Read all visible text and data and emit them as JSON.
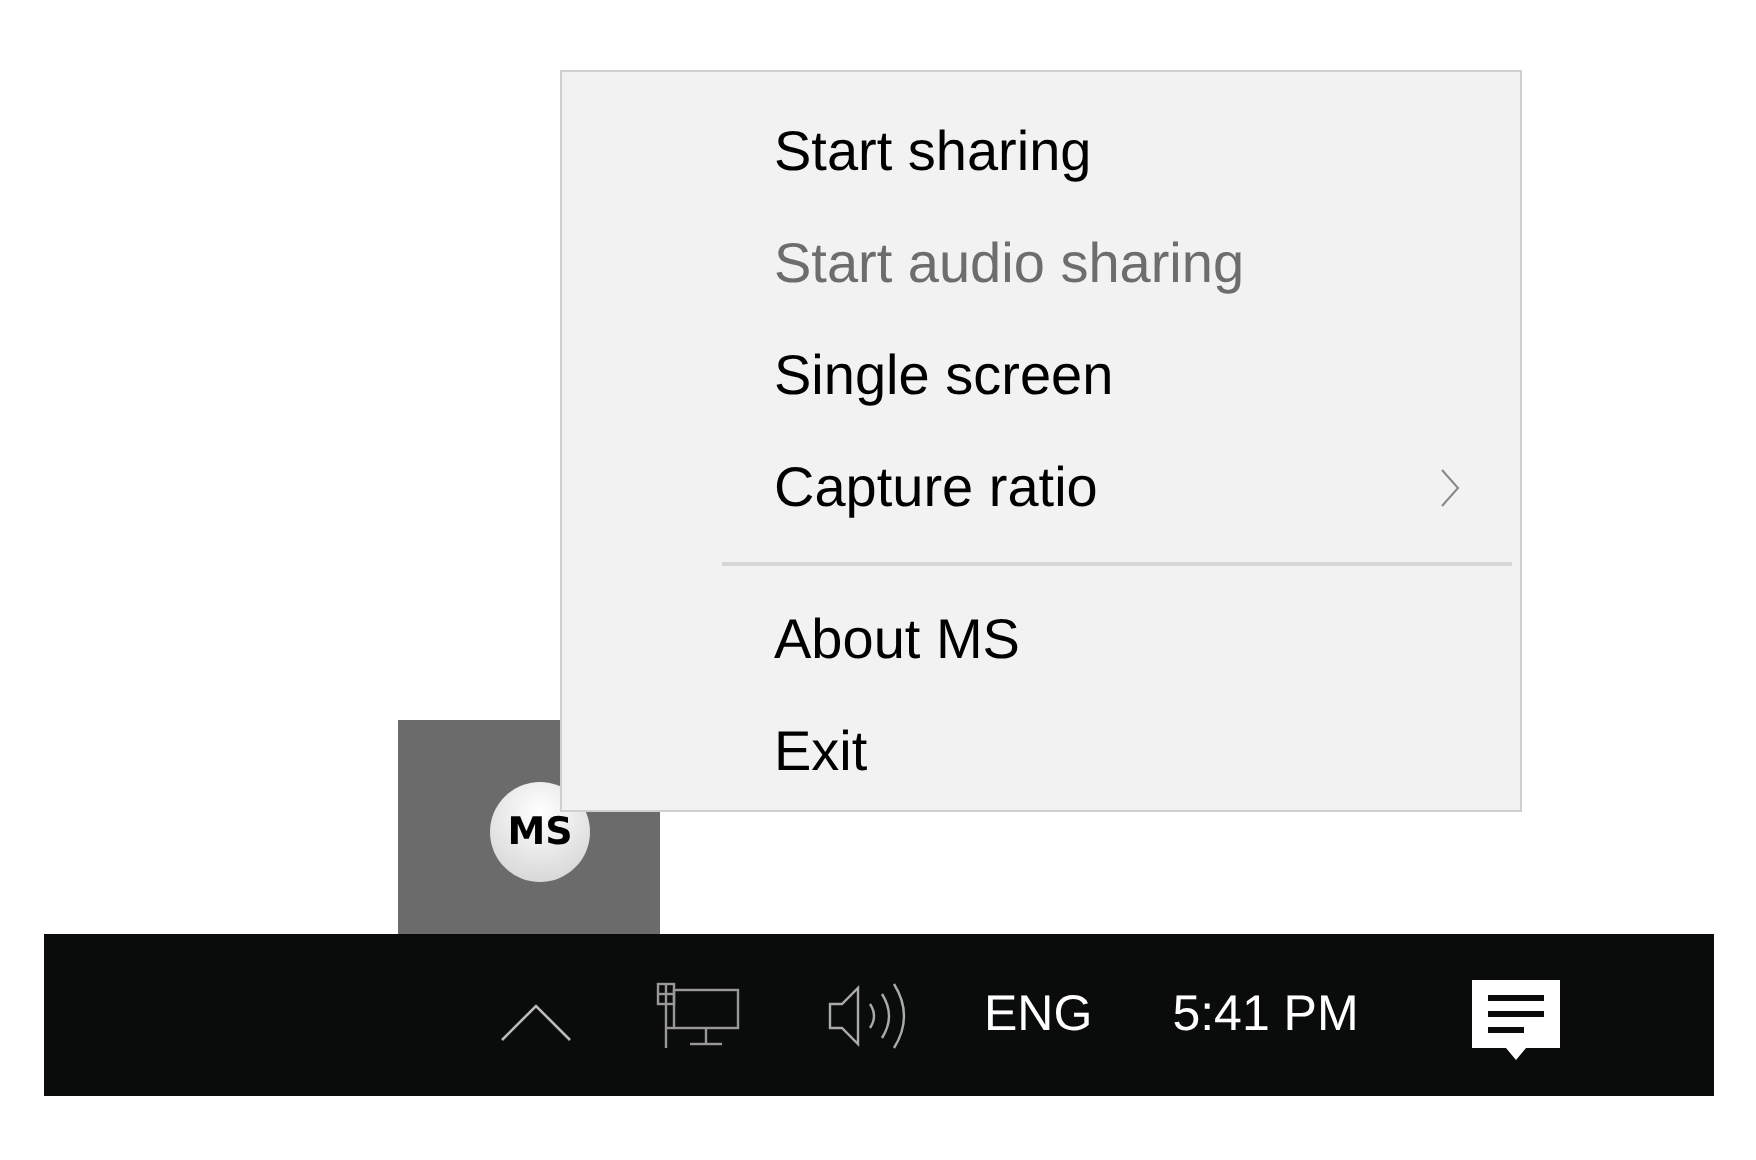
{
  "tray_app": {
    "label": "MS",
    "highlighted": true
  },
  "context_menu": {
    "items": [
      {
        "kind": "item",
        "label": "Start sharing",
        "disabled": false,
        "submenu": false
      },
      {
        "kind": "item",
        "label": "Start audio sharing",
        "disabled": true,
        "submenu": false
      },
      {
        "kind": "item",
        "label": "Single screen",
        "disabled": false,
        "submenu": false
      },
      {
        "kind": "item",
        "label": "Capture ratio",
        "disabled": false,
        "submenu": true
      },
      {
        "kind": "separator"
      },
      {
        "kind": "item",
        "label": "About MS",
        "disabled": false,
        "submenu": false
      },
      {
        "kind": "item",
        "label": "Exit",
        "disabled": false,
        "submenu": false
      }
    ]
  },
  "taskbar": {
    "language": "ENG",
    "time": "5:41 PM"
  }
}
